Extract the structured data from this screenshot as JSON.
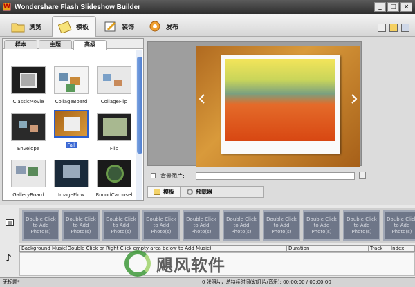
{
  "app": {
    "title": "Wondershare Flash Slideshow Builder",
    "icon": "app-logo-icon"
  },
  "window_buttons": [
    "_",
    "□",
    "×"
  ],
  "main_tabs": [
    {
      "label": "浏览",
      "icon": "folder-icon",
      "active": false
    },
    {
      "label": "模板",
      "icon": "template-icon",
      "active": true
    },
    {
      "label": "装饰",
      "icon": "decoration-icon",
      "active": false
    },
    {
      "label": "发布",
      "icon": "publish-icon",
      "active": false
    }
  ],
  "sub_tabs": [
    {
      "label": "样本"
    },
    {
      "label": "主题"
    },
    {
      "label": "高级",
      "active": true
    }
  ],
  "templates": [
    {
      "name": "ClassicMovie"
    },
    {
      "name": "CollageBoard"
    },
    {
      "name": "CollageFlip"
    },
    {
      "name": "Envelope"
    },
    {
      "name": "Fall",
      "selected": true
    },
    {
      "name": "Flip"
    },
    {
      "name": "GalleryBoard"
    },
    {
      "name": "ImageFlow"
    },
    {
      "name": "RoundCarousel"
    }
  ],
  "background": {
    "label": "背景图片:",
    "value": "",
    "browse": "..."
  },
  "bottom_tabs": [
    {
      "label": "模板",
      "active": true
    },
    {
      "label": "预载器"
    }
  ],
  "slot_label": "Double Click to Add Photo(s)",
  "music_columns": [
    "Background Music(Double Click or Right Click empty area below to Add Music)",
    "Duration",
    "Track",
    "Index"
  ],
  "status": {
    "left": "无标题*",
    "right": "0 张照片，总持续时间(幻灯片/音乐): 00:00:00 / 00:00:00"
  },
  "watermark": "飓风软件",
  "colors": {
    "selection": "#3a68d4",
    "titlebar": "#3a3a3a"
  }
}
